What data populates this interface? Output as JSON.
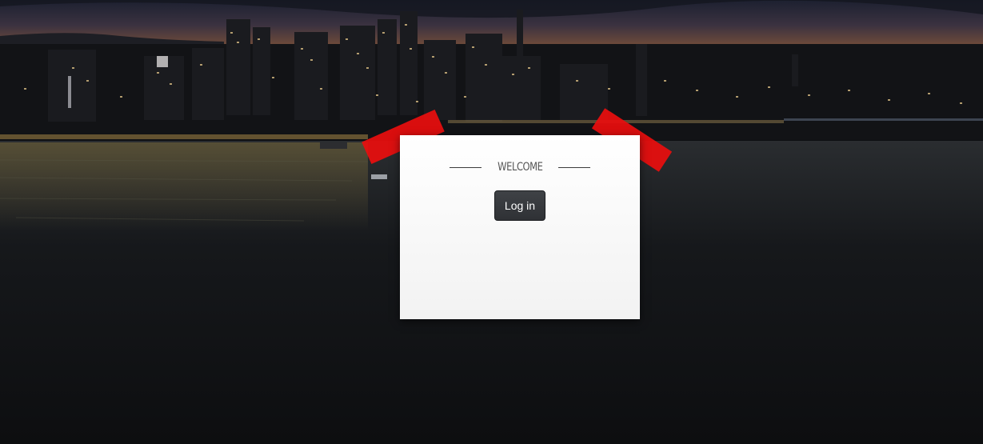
{
  "welcome": {
    "heading": "WELCOME",
    "login_label": "Log in"
  },
  "colors": {
    "tape": "#ea0e0e",
    "button": "#35373b",
    "card": "#ffffff",
    "background": "#0d0e11"
  },
  "icons": {
    "tape_left": "tape-strip",
    "tape_right": "tape-strip"
  }
}
